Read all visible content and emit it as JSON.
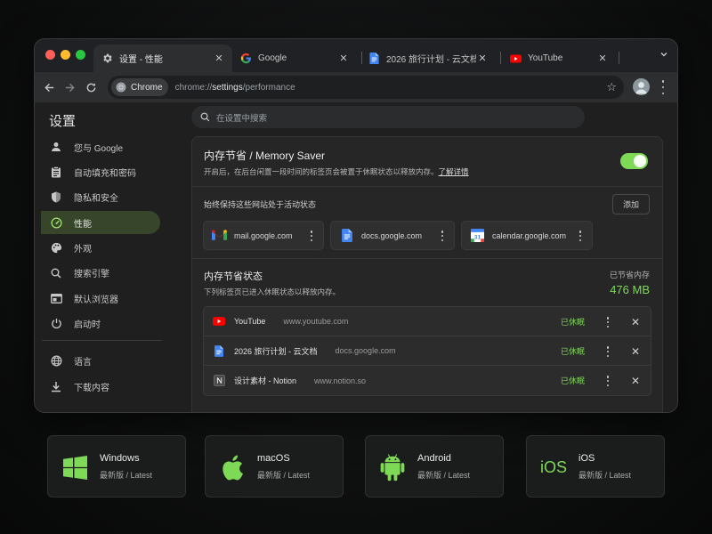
{
  "browser": {
    "tabs": [
      {
        "label": "设置 - 性能",
        "favicon": "gear-icon",
        "active": true
      },
      {
        "label": "Google",
        "favicon": "google-g-icon",
        "active": false
      },
      {
        "label": "2026 旅行计划 - 云文档",
        "favicon": "google-docs-icon",
        "active": false
      },
      {
        "label": "YouTube",
        "favicon": "youtube-icon",
        "active": false
      }
    ],
    "tab_close": "✕",
    "tab_menu": "⌄",
    "omnibox": {
      "chip_label": "Chrome",
      "url_scheme": "chrome://",
      "url_host": "settings",
      "url_path": "/performance"
    }
  },
  "settings": {
    "title": "设置",
    "search_placeholder": "在设置中搜索",
    "sidebar": {
      "items": [
        {
          "label": "您与 Google",
          "icon": "person-icon"
        },
        {
          "label": "自动填充和密码",
          "icon": "clipboard-icon"
        },
        {
          "label": "隐私和安全",
          "icon": "shield-icon"
        },
        {
          "label": "性能",
          "icon": "speedometer-icon",
          "active": true
        },
        {
          "label": "外观",
          "icon": "palette-icon"
        },
        {
          "label": "搜索引擎",
          "icon": "search-icon"
        },
        {
          "label": "默认浏览器",
          "icon": "browser-window-icon"
        },
        {
          "label": "启动时",
          "icon": "power-icon"
        }
      ],
      "items_secondary": [
        {
          "label": "语言",
          "icon": "globe-icon"
        },
        {
          "label": "下载内容",
          "icon": "download-icon"
        }
      ]
    },
    "memory_saver": {
      "title": "内存节省 / Memory Saver",
      "description": "开启后，在后台闲置一段时间的标签页会被置于休眠状态以释放内存。",
      "learn_more": "了解详情",
      "enabled": true
    },
    "always_active": {
      "label": "始终保持这些网站处于活动状态",
      "add_button": "添加",
      "sites": [
        {
          "domain": "mail.google.com",
          "icon": "gmail-icon"
        },
        {
          "domain": "docs.google.com",
          "icon": "google-docs-icon"
        },
        {
          "domain": "calendar.google.com",
          "icon": "google-calendar-icon"
        }
      ]
    },
    "state": {
      "title": "内存节省状态",
      "description": "下列标签页已进入休眠状态以释放内存。",
      "saved_label": "已节省内存",
      "saved_value": "476 MB",
      "tabs": [
        {
          "name": "YouTube",
          "domain": "www.youtube.com",
          "status": "已休眠",
          "icon": "youtube-icon"
        },
        {
          "name": "2026 旅行计划 - 云文档",
          "domain": "docs.google.com",
          "status": "已休眠",
          "icon": "google-docs-icon"
        },
        {
          "name": "设计素材 - Notion",
          "domain": "www.notion.so",
          "status": "已休眠",
          "icon": "notion-icon"
        }
      ],
      "close": "✕"
    }
  },
  "downloads": [
    {
      "name": "Windows",
      "version": "最新版 / Latest",
      "icon": "windows-icon"
    },
    {
      "name": "macOS",
      "version": "最新版 / Latest",
      "icon": "apple-icon"
    },
    {
      "name": "Android",
      "version": "最新版 / Latest",
      "icon": "android-icon"
    },
    {
      "name": "iOS",
      "version": "最新版 / Latest",
      "icon": "ios-icon",
      "icon_text": "iOS"
    }
  ],
  "colors": {
    "accent_green": "#7ed957",
    "active_nav_bg": "#37452a",
    "window_bg": "#1f1f1f"
  }
}
